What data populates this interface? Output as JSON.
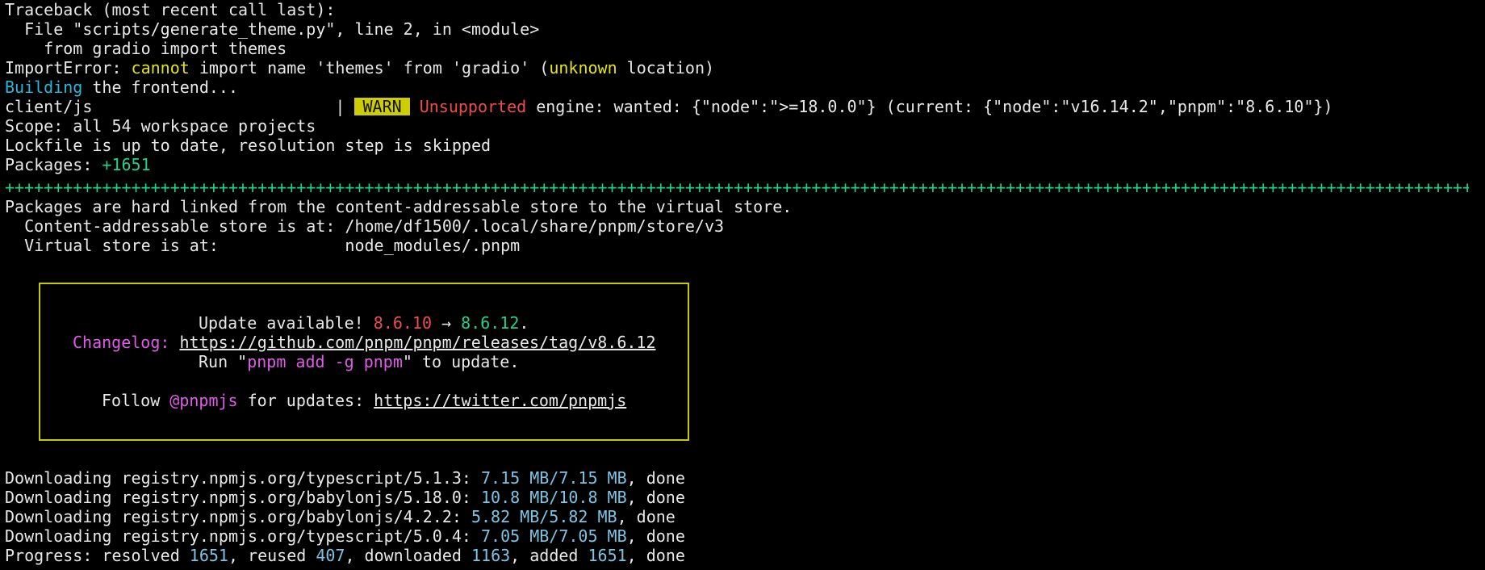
{
  "terminal": {
    "cutoff": "gradio_generate_theme_py_line_cutoff",
    "lines": {
      "l1": "Traceback (most recent call last):",
      "l2": "  File \"scripts/generate_theme.py\", line 2, in <module>",
      "l3": "    from gradio import themes",
      "l4a": "ImportError: ",
      "l4b": "cannot",
      "l4c": " import name 'themes' from 'gradio' (",
      "l4d": "unknown",
      "l4e": " location)",
      "l5a": "Building",
      "l5b": " the frontend...",
      "l6a": "client/js                         | ",
      "l6warn": "WARN",
      "l6b": " Unsupported",
      "l6c": " engine: wanted: {\"node\":\">=18.0.0\"} (current: {\"node\":\"v16.14.2\",\"pnpm\":\"8.6.10\"})",
      "l7": "Scope: all 54 workspace projects",
      "l8": "Lockfile is up to date, resolution step is skipped",
      "l9a": "Packages: ",
      "l9b": "+1651",
      "plus": "++++++++++++++++++++++++++++++++++++++++++++++++++++++++++++++++++++++++++++++++++++++++++++++++++++++++++++++++++++++++++++++++++++++++++++++++++++++++++++++++",
      "l11": "Packages are hard linked from the content-addressable store to the virtual store.",
      "l12": "  Content-addressable store is at: /home/df1500/.local/share/pnpm/store/v3",
      "l13": "  Virtual store is at:             node_modules/.pnpm"
    },
    "update_box": {
      "u1a": "Update available! ",
      "u1_old": "8.6.10",
      "u1_arrow": " → ",
      "u1_new": "8.6.12",
      "u1_end": ".",
      "u2_label": "Changelog:",
      "u2_link": "https://github.com/pnpm/pnpm/releases/tag/v8.6.12",
      "u3a": "Run \"",
      "u3_cmd": "pnpm add -g pnpm",
      "u3b": "\" to update.",
      "u4a": "Follow ",
      "u4_handle": "@pnpmjs",
      "u4b": " for updates: ",
      "u4_link": "https://twitter.com/pnpmjs"
    },
    "downloads": [
      {
        "prefix": "Downloading registry.npmjs.org/typescript/5.1.3: ",
        "size": "7.15 MB/7.15 MB",
        "suffix": ", done"
      },
      {
        "prefix": "Downloading registry.npmjs.org/babylonjs/5.18.0: ",
        "size": "10.8 MB/10.8 MB",
        "suffix": ", done"
      },
      {
        "prefix": "Downloading registry.npmjs.org/babylonjs/4.2.2: ",
        "size": "5.82 MB/5.82 MB",
        "suffix": ", done"
      },
      {
        "prefix": "Downloading registry.npmjs.org/typescript/5.0.4: ",
        "size": "7.05 MB/7.05 MB",
        "suffix": ", done"
      }
    ],
    "progress": {
      "p1": "Progress: resolved ",
      "resolved": "1651",
      "p2": ", reused ",
      "reused": "407",
      "p3": ", downloaded ",
      "downloaded": "1163",
      "p4": ", added ",
      "added": "1651",
      "p5": ", done"
    }
  }
}
